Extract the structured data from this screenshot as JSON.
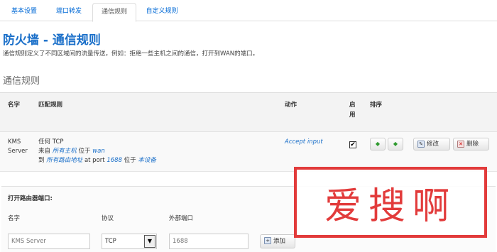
{
  "tabs": [
    "基本设置",
    "端口转发",
    "通信规则",
    "自定义规则"
  ],
  "page": {
    "title": "防火墙 - 通信规则",
    "description": "通信规则定义了不同区域间的流量传送，例如：拒绝一些主机之间的通信，打开到WAN的端口。",
    "section_title": "通信规则"
  },
  "table": {
    "headers": {
      "name": "名字",
      "match": "匹配规则",
      "action": "动作",
      "enable": "启用",
      "sort": "排序"
    }
  },
  "rule": {
    "name_line1": "KMS",
    "name_line2": "Server",
    "match_line1": "任何 TCP",
    "from_prefix": "来自",
    "from_host": "所有主机",
    "from_mid": "位于",
    "from_zone": "wan",
    "to_prefix": "到",
    "to_addr": "所有路由地址",
    "to_port_text": "at port",
    "to_port": "1688",
    "to_mid": "位于",
    "to_device": "本设备",
    "action": "Accept input",
    "enabled": true,
    "check_mark": "✔",
    "edit_label": "修改",
    "delete_label": "删除"
  },
  "add_form": {
    "title": "打开路由器端口:",
    "name_label": "名字",
    "protocol_label": "协议",
    "port_label": "外部端口",
    "name_placeholder": "KMS Server",
    "protocol_value": "TCP",
    "port_placeholder": "1688",
    "add_label": "添加"
  },
  "watermark": {
    "text": "爱搜啊"
  }
}
